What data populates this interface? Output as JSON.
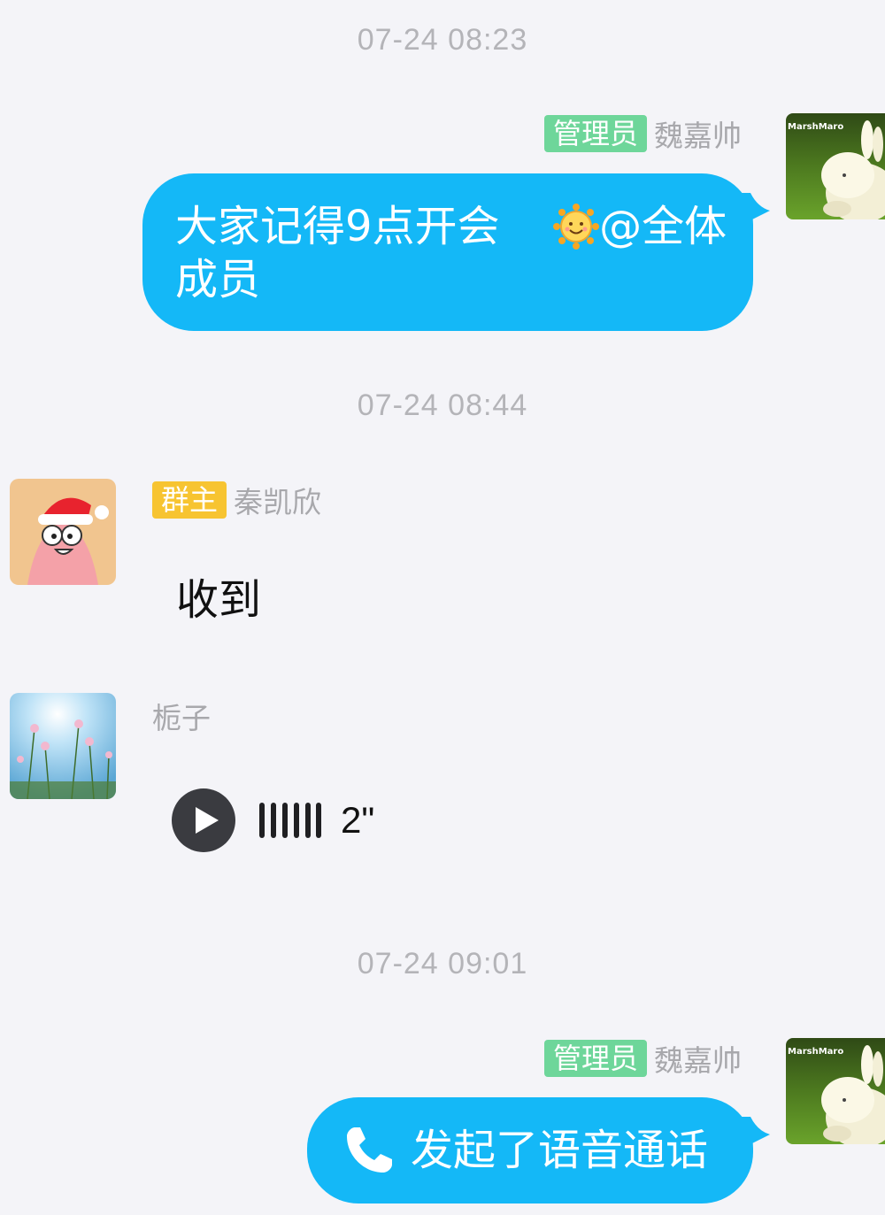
{
  "messages": [
    {
      "timestamp": "07-24 08:23",
      "role": "管理员",
      "sender": "魏嘉帅",
      "text_line1": "大家记得9点开会",
      "mention": "@全体",
      "text_line2": "成员",
      "emoji": "sun-face"
    },
    {
      "timestamp": "07-24 08:44",
      "role": "群主",
      "sender": "秦凯欣",
      "text": "收到"
    },
    {
      "sender": "栀子",
      "voice_duration": "2\""
    },
    {
      "timestamp": "07-24 09:01",
      "role": "管理员",
      "sender": "魏嘉帅",
      "call_text": "发起了语音通话"
    }
  ],
  "avatar_labels": {
    "marshmallow": "MarshMaro"
  },
  "colors": {
    "background": "#f4f4f8",
    "bubble": "#14b8f7",
    "admin_badge": "#6ed69a",
    "owner_badge": "#f7c431",
    "timestamp": "#b4b4b8"
  },
  "icons": [
    "play-icon",
    "voice-wave-icon",
    "phone-icon",
    "sun-emoji-icon"
  ]
}
